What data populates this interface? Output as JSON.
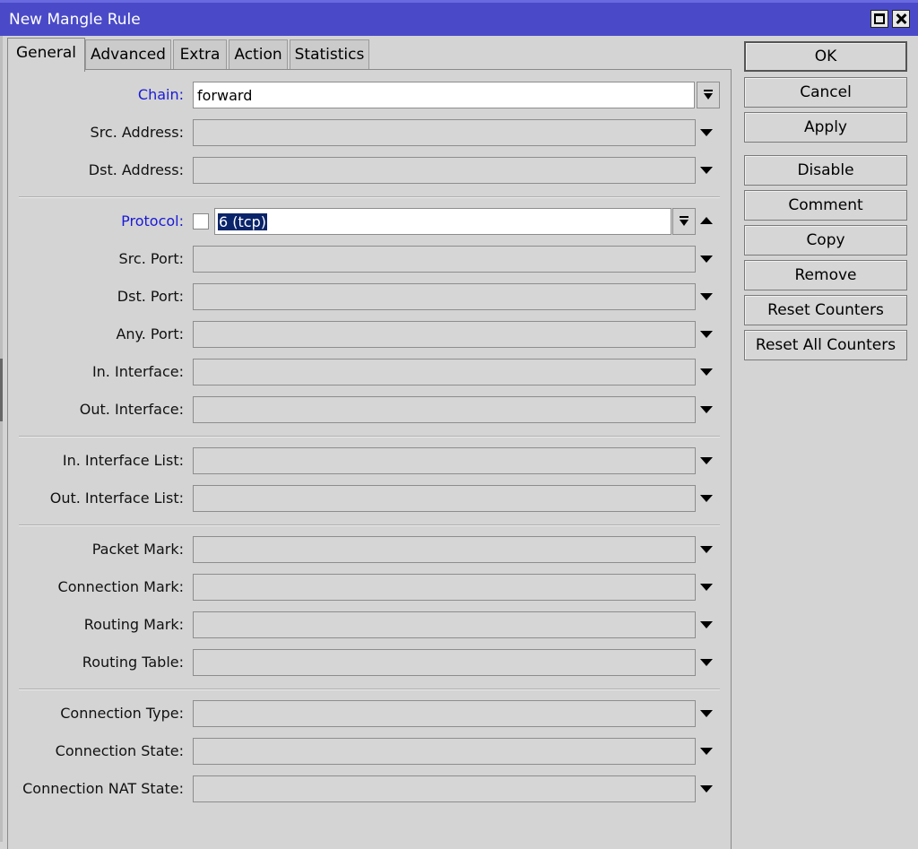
{
  "window": {
    "title": "New Mangle Rule"
  },
  "tabs": [
    "General",
    "Advanced",
    "Extra",
    "Action",
    "Statistics"
  ],
  "fields": {
    "chain": {
      "label": "Chain:",
      "value": "forward"
    },
    "src_address": {
      "label": "Src. Address:"
    },
    "dst_address": {
      "label": "Dst. Address:"
    },
    "protocol": {
      "label": "Protocol:",
      "value": "6 (tcp)"
    },
    "src_port": {
      "label": "Src. Port:"
    },
    "dst_port": {
      "label": "Dst. Port:"
    },
    "any_port": {
      "label": "Any. Port:"
    },
    "in_interface": {
      "label": "In. Interface:"
    },
    "out_interface": {
      "label": "Out. Interface:"
    },
    "in_interface_list": {
      "label": "In. Interface List:"
    },
    "out_interface_list": {
      "label": "Out. Interface List:"
    },
    "packet_mark": {
      "label": "Packet Mark:"
    },
    "connection_mark": {
      "label": "Connection Mark:"
    },
    "routing_mark": {
      "label": "Routing Mark:"
    },
    "routing_table": {
      "label": "Routing Table:"
    },
    "connection_type": {
      "label": "Connection Type:"
    },
    "connection_state": {
      "label": "Connection State:"
    },
    "connection_nat_state": {
      "label": "Connection NAT State:"
    }
  },
  "buttons": {
    "ok": "OK",
    "cancel": "Cancel",
    "apply": "Apply",
    "disable": "Disable",
    "comment": "Comment",
    "copy": "Copy",
    "remove": "Remove",
    "reset_counters": "Reset Counters",
    "reset_all_counters": "Reset All Counters"
  },
  "colors": {
    "titlebar": "#4a4ac8",
    "label_highlight": "#1a1ad6",
    "selection": "#0a246a"
  }
}
